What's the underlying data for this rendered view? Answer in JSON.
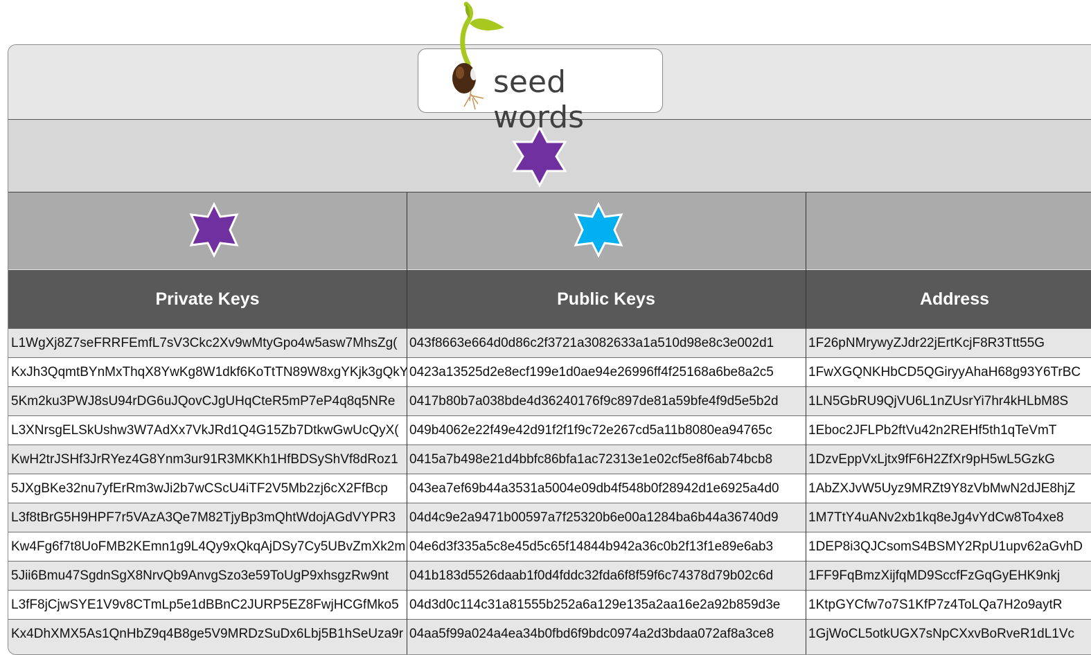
{
  "logo": {
    "text": "seed words"
  },
  "stars": {
    "top_color": "#7030a0",
    "left_color": "#7030a0",
    "middle_color": "#00b0f0"
  },
  "columns": [
    "Private Keys",
    "Public Keys",
    "Address"
  ],
  "rows": [
    [
      "L1WgXj8Z7seFRRFEmfL7sV3Ckc2Xv9wMtyGpo4w5asw7MhsZg(",
      "043f8663e664d0d86c2f3721a3082633a1a510d98e8c3e002d1",
      "1F26pNMrywyZJdr22jErtKcjF8R3Ttt55G"
    ],
    [
      "KxJh3QqmtBYnMxThqX8YwKg8W1dkf6KoTtTN89W8xgYKjk3gQkY",
      "0423a13525d2e8ecf199e1d0ae94e26996ff4f25168a6be8a2c5",
      "1FwXGQNKHbCD5QGiryyAhaH68g93Y6TrBC"
    ],
    [
      "5Km2ku3PWJ8sU94rDG6uJQovCJgUHqCteR5mP7eP4q8q5NRe",
      "0417b80b7a038bde4d36240176f9c897de81a59bfe4f9d5e5b2d",
      "1LN5GbRU9QjVU6L1nZUsrYi7hr4kHLbM8S"
    ],
    [
      "L3XNrsgELSkUshw3W7AdXx7VkJRd1Q4G15Zb7DtkwGwUcQyX(",
      "049b4062e22f49e42d91f2f1f9c72e267cd5a11b8080ea94765c",
      "1Eboc2JFLPb2ftVu42n2REHf5th1qTeVmT"
    ],
    [
      "KwH2trJSHf3JrRYez4G8Ynm3ur91R3MKKh1HfBDSyShVf8dRoz1",
      "0415a7b498e21d4bbfc86bfa1ac72313e1e02cf5e8f6ab74bcb8",
      "1DzvEppVxLjtx9fF6H2ZfXr9pH5wL5GzkG"
    ],
    [
      "5JXgBKe32nu7yfErRm3wJi2b7wCScU4iTF2V5Mb2zj6cX2FfBcp",
      "043ea7ef69b44a3531a5004e09db4f548b0f28942d1e6925a4d0",
      "1AbZXJvW5Uyz9MRZt9Y8zVbMwN2dJE8hjZ"
    ],
    [
      "L3f8tBrG5H9HPF7r5VAzA3Qe7M82TjyBp3mQhtWdojAGdVYPR3",
      "04d4c9e2a9471b00597a7f25320b6e00a1284ba6b44a36740d9",
      "1M7TtY4uANv2xb1kq8eJg4vYdCw8To4xe8"
    ],
    [
      "Kw4Fg6f7t8UoFMB2KEmn1g9L4Qy9xQkqAjDSy7Cy5UBvZmXk2m",
      "04e6d3f335a5c8e45d5c65f14844b942a36c0b2f13f1e89e6ab3",
      "1DEP8i3QJCsomS4BSMY2RpU1upv62aGvhD"
    ],
    [
      "5Jii6Bmu47SgdnSgX8NrvQb9AnvgSzo3e59ToUgP9xhsgzRw9nt",
      "041b183d5526daab1f0d4fddc32fda6f8f59f6c74378d79b02c6d",
      "1FF9FqBmzXijfqMD9SccfFzGqGyEHK9nkj"
    ],
    [
      "L3fF8jCjwSYE1V9v8CTmLp5e1dBBnC2JURP5EZ8FwjHCGfMko5",
      "04d3d0c114c31a81555b252a6a129e135a2aa16e2a92b859d3e",
      "1KtpGYCfw7o7S1KfP7z4ToLQa7H2o9aytR"
    ],
    [
      "Kx4DhXMX5As1QnHbZ9q4B8ge5V9MRDzSuDx6Lbj5B1hSeUza9r",
      "04aa5f99a024a4ea34b0fbd6f9bdc0974a2d3bdaa072af8a3ce8",
      "1GjWoCL5otkUGX7sNpCXxvBoRveR1dL1Vc"
    ]
  ]
}
